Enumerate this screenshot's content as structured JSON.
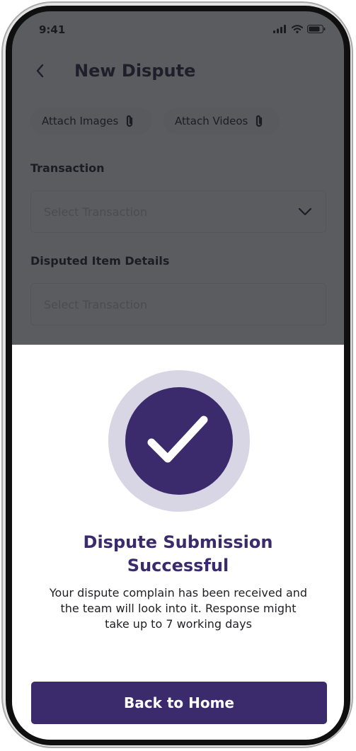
{
  "status_bar": {
    "time": "9:41"
  },
  "header": {
    "title": "New Dispute"
  },
  "attachments": {
    "images_label": "Attach Images",
    "videos_label": "Attach Videos"
  },
  "form": {
    "transaction_label": "Transaction",
    "transaction_placeholder": "Select Transaction",
    "item_details_label": "Disputed Item Details",
    "item_details_placeholder": "Select Transaction"
  },
  "modal": {
    "title_line1": "Dispute Submission",
    "title_line2": "Successful",
    "message_line1": "Your dispute complain has been received and",
    "message_line2": "the team will look into it. Response might",
    "message_line3": "take up to 7 working days",
    "button_label": "Back to Home"
  },
  "colors": {
    "accent": "#3b2b6c",
    "ring": "#d8d5e4",
    "overlay": "#5b5c60"
  },
  "icons": [
    "signal-icon",
    "wifi-icon",
    "battery-icon",
    "back-arrow-icon",
    "paperclip-icon",
    "chevron-down-icon",
    "checkmark-icon"
  ]
}
